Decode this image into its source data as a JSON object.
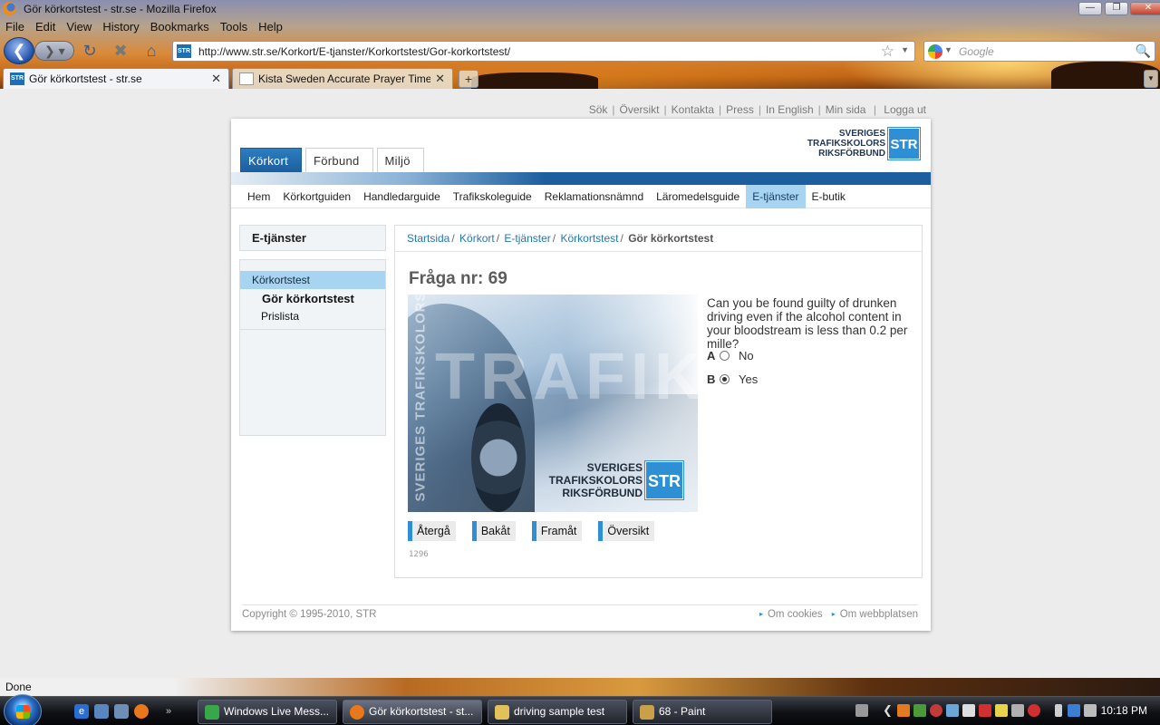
{
  "window": {
    "title": "Gör körkortstest - str.se - Mozilla Firefox",
    "minimize": "—",
    "maximize": "❐",
    "close": "✕"
  },
  "menu": [
    "File",
    "Edit",
    "View",
    "History",
    "Bookmarks",
    "Tools",
    "Help"
  ],
  "toolbar": {
    "url": "http://www.str.se/Korkort/E-tjanster/Korkortstest/Gor-korkortstest/",
    "search_placeholder": "Google",
    "site_icon_text": "STR"
  },
  "tabs": [
    {
      "label": "Gör körkortstest - str.se",
      "active": true
    },
    {
      "label": "Kista Sweden Accurate Prayer Times...",
      "active": false
    }
  ],
  "page": {
    "top_links": [
      "Sök",
      "Översikt",
      "Kontakta",
      "Press",
      "In English",
      "Min sida",
      "Logga ut"
    ],
    "main_tabs": [
      "Körkort",
      "Förbund",
      "Miljö"
    ],
    "logo": {
      "line1": "SVERIGES",
      "line2": "TRAFIKSKOLORS",
      "line3": "RIKSFÖRBUND",
      "box": "STR"
    },
    "sub_nav": [
      "Hem",
      "Körkortguiden",
      "Handledarguide",
      "Trafikskoleguide",
      "Reklamationsnämnd",
      "Läromedelsguide",
      "E-tjänster",
      "E-butik"
    ],
    "sub_nav_active": "E-tjänster",
    "sidebar": {
      "heading": "E-tjänster",
      "selected": "Körkortstest",
      "items": [
        "Gör körkortstest",
        "Prislista"
      ]
    },
    "breadcrumb": {
      "links": [
        "Startsida",
        "Körkort",
        "E-tjänster",
        "Körkortstest"
      ],
      "current": "Gör körkortstest"
    },
    "question": {
      "title": "Fråga nr: 69",
      "text": "Can you be found guilty of drunken driving even if the alcohol content in your bloodstream is less than 0.2 per mille?",
      "image_watermark": "TRAFIKSKOLORS",
      "image_side_text": "SVERIGES TRAFIKSKOLORS RI",
      "options": [
        {
          "letter": "A",
          "label": "No",
          "checked": false
        },
        {
          "letter": "B",
          "label": "Yes",
          "checked": true
        }
      ],
      "buttons": [
        "Återgå",
        "Bakåt",
        "Framåt",
        "Översikt"
      ],
      "id": "1296"
    },
    "footer": {
      "copyright": "Copyright © 1995-2010, STR",
      "links": [
        "Om cookies",
        "Om webbplatsen"
      ]
    }
  },
  "status": "Done",
  "taskbar": {
    "buttons": [
      {
        "label": "Windows Live Mess...",
        "active": false
      },
      {
        "label": "Gör körkortstest - st...",
        "active": true
      },
      {
        "label": "driving sample test",
        "active": false
      },
      {
        "label": "68 - Paint",
        "active": false
      }
    ],
    "clock": "10:18 PM"
  }
}
